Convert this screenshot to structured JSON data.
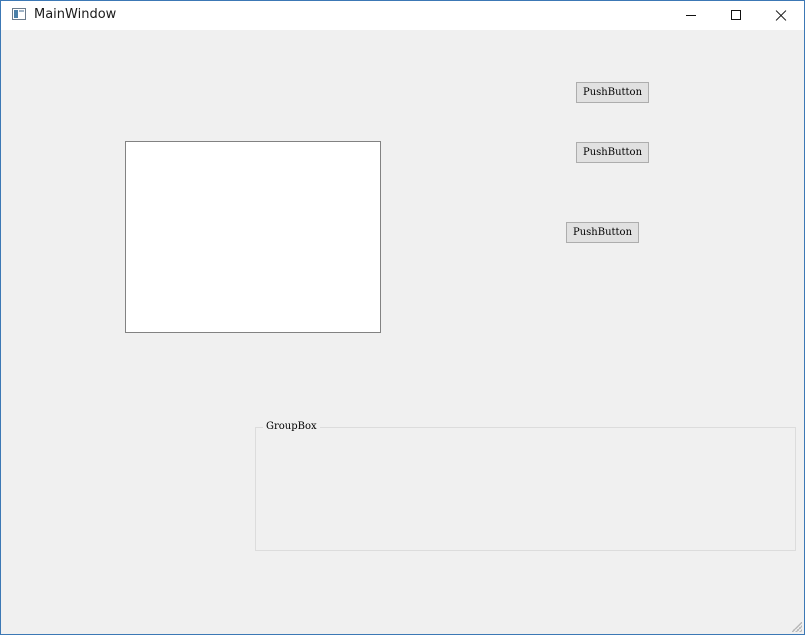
{
  "window": {
    "title": "MainWindow"
  },
  "titlebar": {
    "app_icon": "window-app-icon",
    "minimize_icon": "minimize-icon",
    "maximize_icon": "maximize-icon",
    "close_icon": "close-icon"
  },
  "buttons": [
    {
      "label": "PushButton"
    },
    {
      "label": "PushButton"
    },
    {
      "label": "PushButton"
    }
  ],
  "group_box": {
    "title": "GroupBox"
  },
  "colors": {
    "window_border": "#3c78b5",
    "client_background": "#f0f0f0",
    "button_background": "#e1e1e1",
    "button_border": "#adadad"
  }
}
